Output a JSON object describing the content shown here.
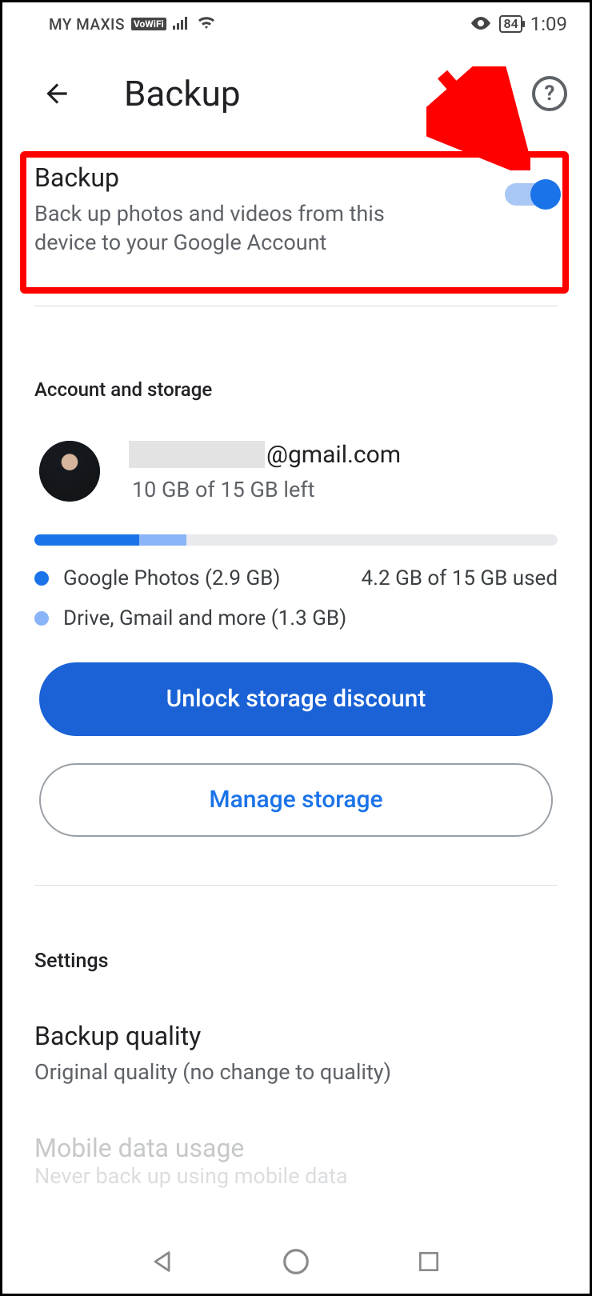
{
  "status_bar": {
    "carrier": "MY MAXIS",
    "vowifi": "VoWiFi",
    "battery": "84",
    "time": "1:09"
  },
  "app_bar": {
    "title": "Backup",
    "help": "?"
  },
  "backup_toggle": {
    "title": "Backup",
    "description": "Back up photos and videos from this device to your Google Account",
    "enabled": true
  },
  "account_section": {
    "header": "Account and storage",
    "email_suffix": "@gmail.com",
    "storage_left": "10 GB of 15 GB left",
    "storage_used_text": "4.2 GB of 15 GB used",
    "legend": {
      "photos": "Google Photos (2.9 GB)",
      "drive": "Drive, Gmail and more (1.3 GB)"
    },
    "progress": {
      "photos_pct": 19,
      "drive_pct": 9
    },
    "unlock_btn": "Unlock storage discount",
    "manage_btn": "Manage storage"
  },
  "settings": {
    "header": "Settings",
    "backup_quality": {
      "title": "Backup quality",
      "subtitle": "Original quality (no change to quality)"
    },
    "mobile_data": {
      "title": "Mobile data usage",
      "subtitle": "Never back up using mobile data"
    }
  },
  "colors": {
    "accent": "#1a73e8",
    "annotation": "#ff0000"
  }
}
